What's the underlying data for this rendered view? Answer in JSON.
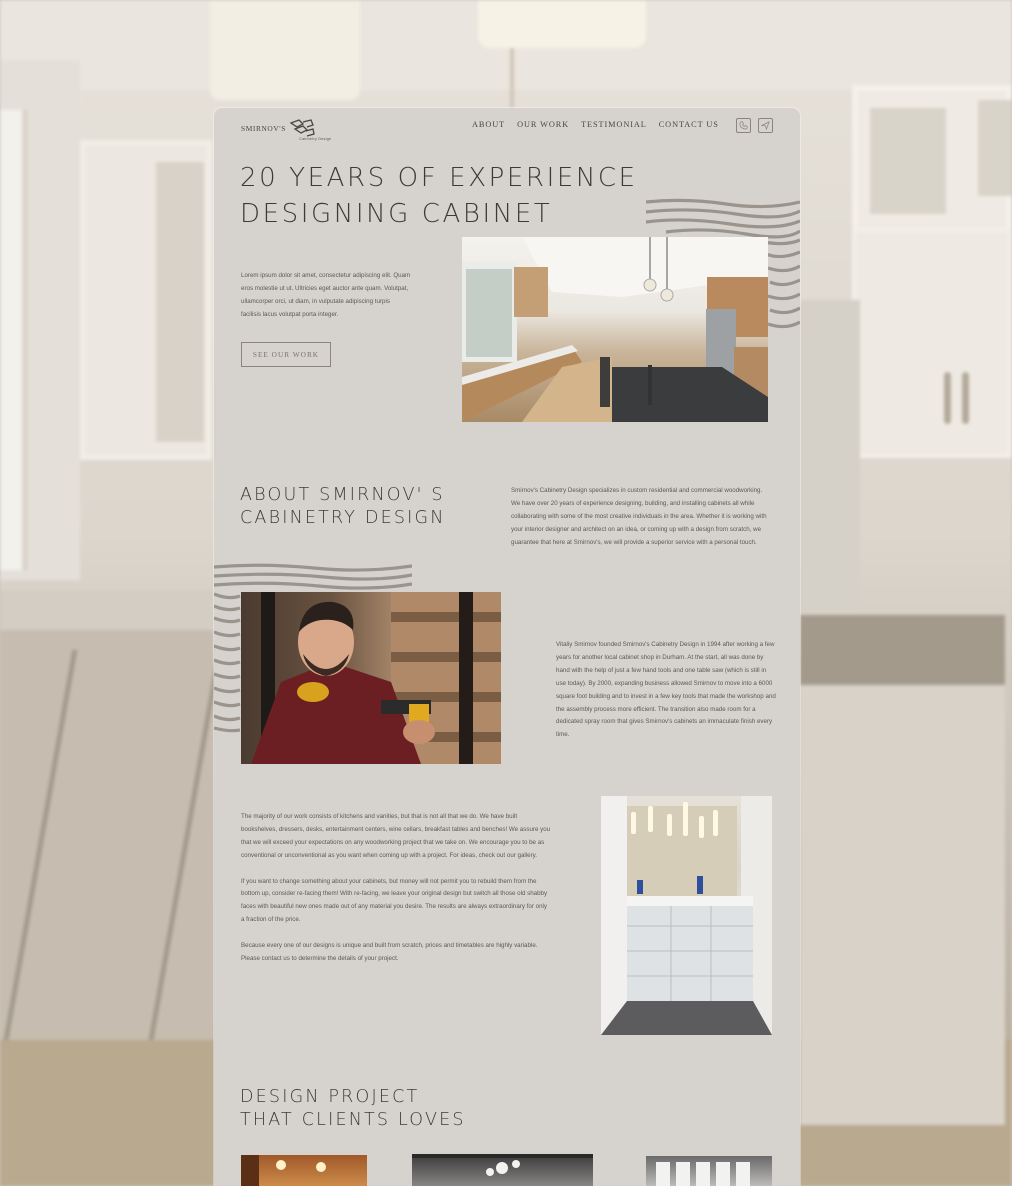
{
  "site": {
    "logo_word": "SMIRNOV'S",
    "logo_sub": "Cabinetry Design"
  },
  "nav": {
    "items": [
      "ABOUT",
      "OUR WORK",
      "TESTIMONIAL",
      "CONTACT US"
    ],
    "icons": [
      "phone-icon",
      "send-icon"
    ]
  },
  "hero": {
    "title_line1": "20 YEARS OF EXPERIENCE",
    "title_line2": "DESIGNING CABINET",
    "body": "Lorem ipsum dolor sit amet, consectetur adipiscing elit. Quam eros molestie ut ut. Ultricies eget auctor ante quam. Volutpat, ullamcorper orci, ut diam, in vulputate adipiscing turpis facilisis lacus volutpat porta integer.",
    "cta_label": "SEE OUR WORK"
  },
  "about": {
    "title_line1": "ABOUT SMIRNOV' S",
    "title_line2": "CABINETRY DESIGN",
    "body": "Smirnov's Cabinetry Design specializes in custom residential and commercial woodworking. We have over 20 years of experience designing, building, and installing cabinets all while collaborating with some of the most creative individuals in the area. Whether it is working with your interior designer and architect on an idea, or coming up with a design from scratch, we guarantee that here at Smirnov's, we will provide a superior service with a personal touch.",
    "founder": "Vitaliy Smirnov founded Smirnov's Cabinetry Design in 1994 after working a few years for another local cabinet shop in Durham. At the start, all was done by hand with the help of just a few hand tools and one table saw (which is still in use today). By 2000, expanding business allowed Smirnov to move into a 6000 square foot building and to invest in a few key tools that made the workshop and the assembly process more efficient. The transition also made room for a dedicated spray room that gives Smirnov's cabinets an immaculate finish every time."
  },
  "work": {
    "paragraphs": [
      "The majority of our work consists of kitchens and vanities, but that is not all that we do. We have built bookshelves, dressers, desks, entertainment centers, wine cellars, breakfast tables and benches! We assure you that we will exceed your expectations on any woodworking project that we take on. We encourage you to be as conventional or unconventional as you want when coming up with a project. For ideas, check out our gallery.",
      "If you want to change something about your cabinets, but money will not permit you to rebuild them from the bottom up, consider re-facing them! With re-facing, we leave your original design but switch all those old shabby faces with beautiful new ones made out of any material you desire. The results are always extraordinary for only a fraction of the price.",
      "Because every one of our designs is unique and built from scratch, prices and timetables are highly variable. Please contact us to determine the details of your project."
    ]
  },
  "projects": {
    "title_line1": "DESIGN PROJECT",
    "title_line2": "THAT CLIENTS LOVES"
  },
  "colors": {
    "card_bg": "#d6d2cd",
    "text_dark": "#3e3a36",
    "text_body": "#5d5853",
    "grain": "#9a948d"
  }
}
